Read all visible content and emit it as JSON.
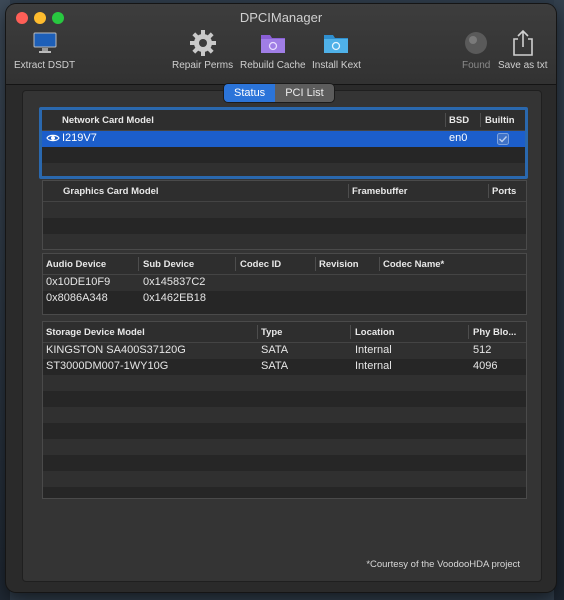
{
  "window": {
    "title": "DPCIManager"
  },
  "toolbar": {
    "extract_dsdt": "Extract DSDT",
    "repair_perms": "Repair Perms",
    "rebuild_cache": "Rebuild Cache",
    "install_kext": "Install Kext",
    "found": "Found",
    "save_as_txt": "Save as txt"
  },
  "tabs": {
    "status": "Status",
    "pci_list": "PCI List"
  },
  "network": {
    "headers": {
      "model": "Network Card Model",
      "bsd": "BSD",
      "builtin": "Builtin"
    },
    "rows": [
      {
        "model": "I219V7",
        "bsd": "en0",
        "builtin": true
      }
    ]
  },
  "graphics": {
    "headers": {
      "model": "Graphics Card Model",
      "framebuffer": "Framebuffer",
      "ports": "Ports"
    },
    "rows": []
  },
  "audio": {
    "headers": {
      "device": "Audio Device",
      "sub_device": "Sub Device",
      "codec_id": "Codec ID",
      "revision": "Revision",
      "codec_name": "Codec Name*"
    },
    "rows": [
      {
        "device": "0x10DE10F9",
        "sub_device": "0x145837C2"
      },
      {
        "device": "0x8086A348",
        "sub_device": "0x1462EB18"
      }
    ]
  },
  "storage": {
    "headers": {
      "model": "Storage Device Model",
      "type": "Type",
      "location": "Location",
      "phy_block": "Phy Blo..."
    },
    "rows": [
      {
        "model": "KINGSTON SA400S37120G",
        "type": "SATA",
        "location": "Internal",
        "phy_block": "512"
      },
      {
        "model": "ST3000DM007-1WY10G",
        "type": "SATA",
        "location": "Internal",
        "phy_block": "4096"
      }
    ]
  },
  "footer": "*Courtesy of the VoodooHDA project",
  "colors": {
    "selection": "#1c5ecb",
    "accent": "#2b74d9",
    "focus_ring": "#2a68ae"
  },
  "icons": [
    "monitor-icon",
    "gear-icon",
    "purple-folder-icon",
    "blue-folder-icon",
    "found-icon",
    "share-icon",
    "eye-icon",
    "checkbox-icon"
  ]
}
